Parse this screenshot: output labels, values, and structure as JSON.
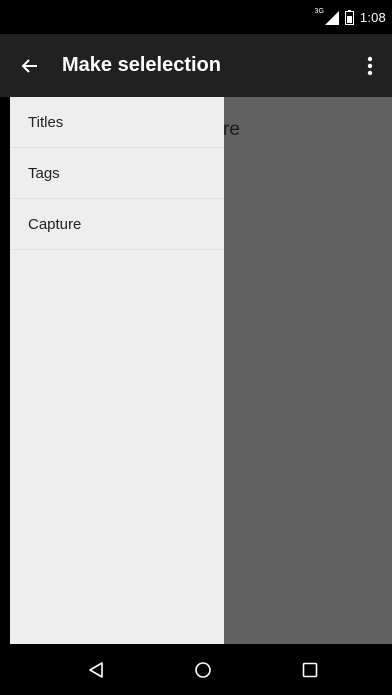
{
  "status_bar": {
    "network_type": "3G",
    "time": "1:08",
    "icons": [
      "signal-icon",
      "battery-icon"
    ]
  },
  "toolbar": {
    "title": "Make selelection",
    "back_icon": "arrow-back-icon",
    "overflow_icon": "more-vert-icon"
  },
  "background_content": {
    "partial_text": "re"
  },
  "drawer": {
    "items": [
      {
        "label": "Titles"
      },
      {
        "label": "Tags"
      },
      {
        "label": "Capture"
      }
    ]
  },
  "nav_bar": {
    "icons": [
      "back-triangle-icon",
      "home-circle-icon",
      "recents-square-icon"
    ]
  },
  "colors": {
    "toolbar": "#212121",
    "drawer": "#eeeeee",
    "scrim": "#616161",
    "status_bar": "#000000"
  }
}
